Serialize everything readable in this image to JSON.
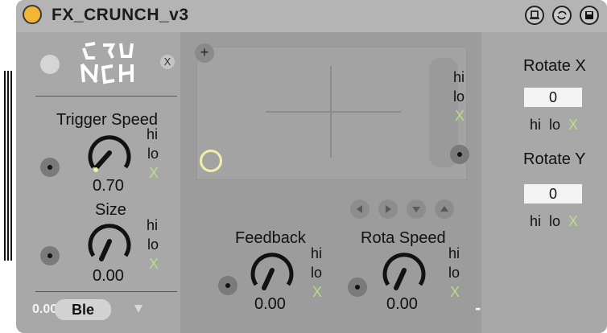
{
  "title": "FX_CRUNCH_v3",
  "logo_text": "CRUNCH",
  "title_buttons": [
    "pin-icon",
    "refresh-icon",
    "save-icon"
  ],
  "close_glyph": "X",
  "plus_glyph": "+",
  "trigger": {
    "label": "Trigger Speed",
    "value": "0.70",
    "hi": "hi",
    "lo": "lo",
    "x": "X"
  },
  "size": {
    "label": "Size",
    "value": "0.00",
    "hi": "hi",
    "lo": "lo",
    "x": "X"
  },
  "xy_pad": {
    "hi": "hi",
    "lo": "lo",
    "x": "X"
  },
  "feedback": {
    "label": "Feedback",
    "value": "0.00",
    "hi": "hi",
    "lo": "lo",
    "x": "X"
  },
  "rota_speed": {
    "label": "Rota Speed",
    "value": "0.00",
    "hi": "hi",
    "lo": "lo",
    "x": "X"
  },
  "rotate_x": {
    "label": "Rotate X",
    "value": "0",
    "hi": "hi",
    "lo": "lo",
    "x": "X"
  },
  "rotate_y": {
    "label": "Rotate Y",
    "value": "0",
    "hi": "hi",
    "lo": "lo",
    "x": "X"
  },
  "bottom": {
    "value": "0.00",
    "dropdown": "Ble",
    "dash": "-"
  },
  "colors": {
    "accent_yellow": "#f3b634",
    "green": "#b9dc86",
    "panel": "#a8a8a8"
  }
}
